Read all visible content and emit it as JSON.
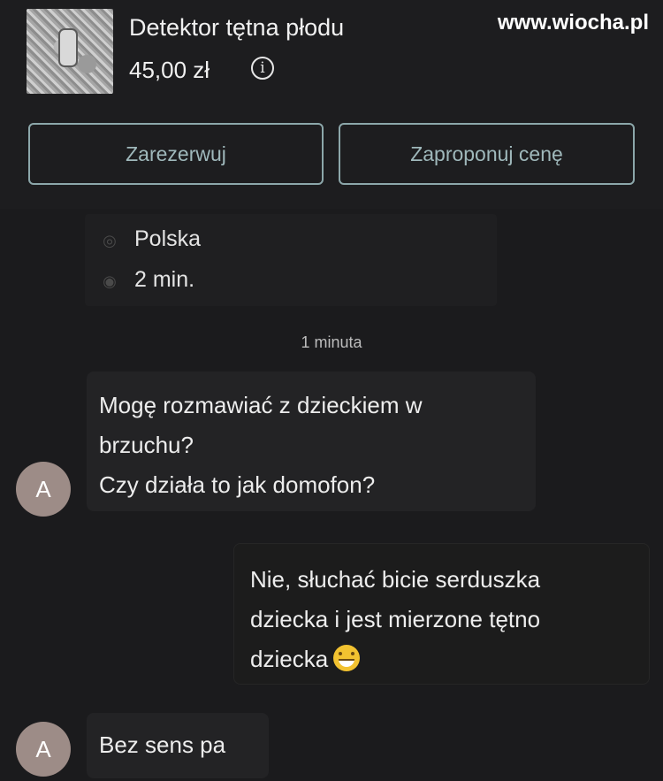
{
  "watermark": "www.wiocha.pl",
  "product": {
    "title": "Detektor tętna płodu",
    "price": "45,00 zł",
    "info_glyph": "i"
  },
  "actions": {
    "reserve_label": "Zarezerwuj",
    "offer_label": "Zaproponuj cenę"
  },
  "listing_meta": {
    "location": "Polska",
    "location_icon": "location-pin-icon",
    "views": "2 min.",
    "views_icon": "eye-icon"
  },
  "timestamp": "1 minuta",
  "messages": [
    {
      "sender": "other",
      "avatar_letter": "A",
      "lines": [
        "Mogę rozmawiać z dzieckiem w",
        "brzuchu?",
        "Czy działa to jak domofon?"
      ]
    },
    {
      "sender": "me",
      "lines": [
        "Nie, słuchać bicie serduszka",
        "dziecka i jest mierzone tętno",
        "dziecka"
      ],
      "emoji": "grinning-sweat-emoji"
    },
    {
      "sender": "other",
      "avatar_letter": "A",
      "lines": [
        "Bez sens pa"
      ]
    }
  ],
  "colors": {
    "background": "#1b1b1d",
    "button_border": "#8ca7aa",
    "avatar": "#9d8c87"
  }
}
